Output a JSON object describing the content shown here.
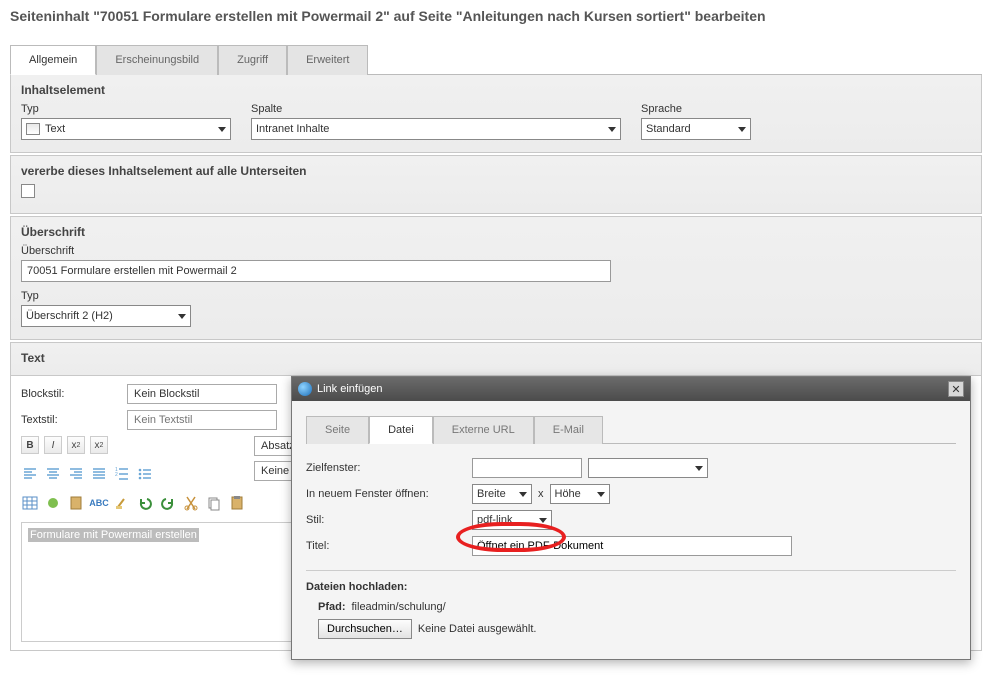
{
  "page_title": "Seiteninhalt \"70051 Formulare erstellen mit Powermail 2\" auf Seite \"Anleitungen nach Kursen sortiert\" bearbeiten",
  "tabs": {
    "allgemein": "Allgemein",
    "erscheinungsbild": "Erscheinungsbild",
    "zugriff": "Zugriff",
    "erweitert": "Erweitert"
  },
  "inhaltselement": {
    "heading": "Inhaltselement",
    "typ_label": "Typ",
    "typ_value": "Text",
    "spalte_label": "Spalte",
    "spalte_value": "Intranet Inhalte",
    "sprache_label": "Sprache",
    "sprache_value": "Standard"
  },
  "vererbe": {
    "heading": "vererbe dieses Inhaltselement auf alle Unterseiten"
  },
  "ueberschrift": {
    "heading": "Überschrift",
    "label": "Überschrift",
    "value": "70051 Formulare erstellen mit Powermail 2",
    "typ_label": "Typ",
    "typ_value": "Überschrift 2 (H2)"
  },
  "text_section": {
    "heading": "Text",
    "blockstil_label": "Blockstil:",
    "blockstil_value": "Kein Blockstil",
    "textstil_label": "Textstil:",
    "textstil_placeholder": "Kein Textstil",
    "format_value": "Absatz",
    "sprache_value": "Keine Sprache",
    "selected_text": "Formulare mit Powermail erstellen"
  },
  "dialog": {
    "title": "Link einfügen",
    "tabs": {
      "seite": "Seite",
      "datei": "Datei",
      "externe_url": "Externe URL",
      "email": "E-Mail"
    },
    "zielfenster_label": "Zielfenster:",
    "neues_fenster_label": "In neuem Fenster öffnen:",
    "breite_label": "Breite",
    "x_label": "x",
    "hoehe_label": "Höhe",
    "stil_label": "Stil:",
    "stil_value": "pdf-link",
    "titel_label": "Titel:",
    "titel_value": "Öffnet ein PDF-Dokument",
    "upload_heading": "Dateien hochladen:",
    "pfad_label": "Pfad:",
    "pfad_value": "fileadmin/schulung/",
    "browse_label": "Durchsuchen…",
    "no_file": "Keine Datei ausgewählt."
  }
}
